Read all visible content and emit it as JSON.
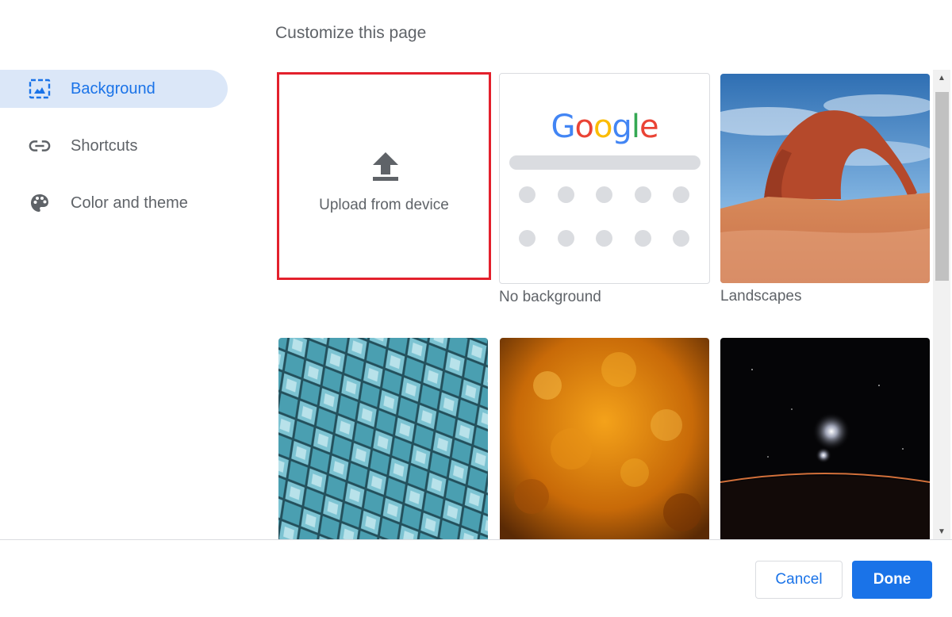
{
  "dialog": {
    "title": "Customize this page"
  },
  "sidebar": {
    "items": [
      {
        "label": "Background",
        "icon": "image-icon",
        "active": true
      },
      {
        "label": "Shortcuts",
        "icon": "link-icon",
        "active": false
      },
      {
        "label": "Color and theme",
        "icon": "palette-icon",
        "active": false
      }
    ]
  },
  "backgrounds": {
    "upload_label": "Upload from device",
    "no_background_label": "No background",
    "landscapes_label": "Landscapes",
    "google_logo_text": [
      "G",
      "o",
      "o",
      "g",
      "l",
      "e"
    ]
  },
  "footer": {
    "cancel_label": "Cancel",
    "done_label": "Done"
  },
  "colors": {
    "accent": "#1a73e8",
    "active_nav_bg": "#dbe7f8",
    "selection_border": "#e3202c",
    "text_secondary": "#5f6368"
  }
}
